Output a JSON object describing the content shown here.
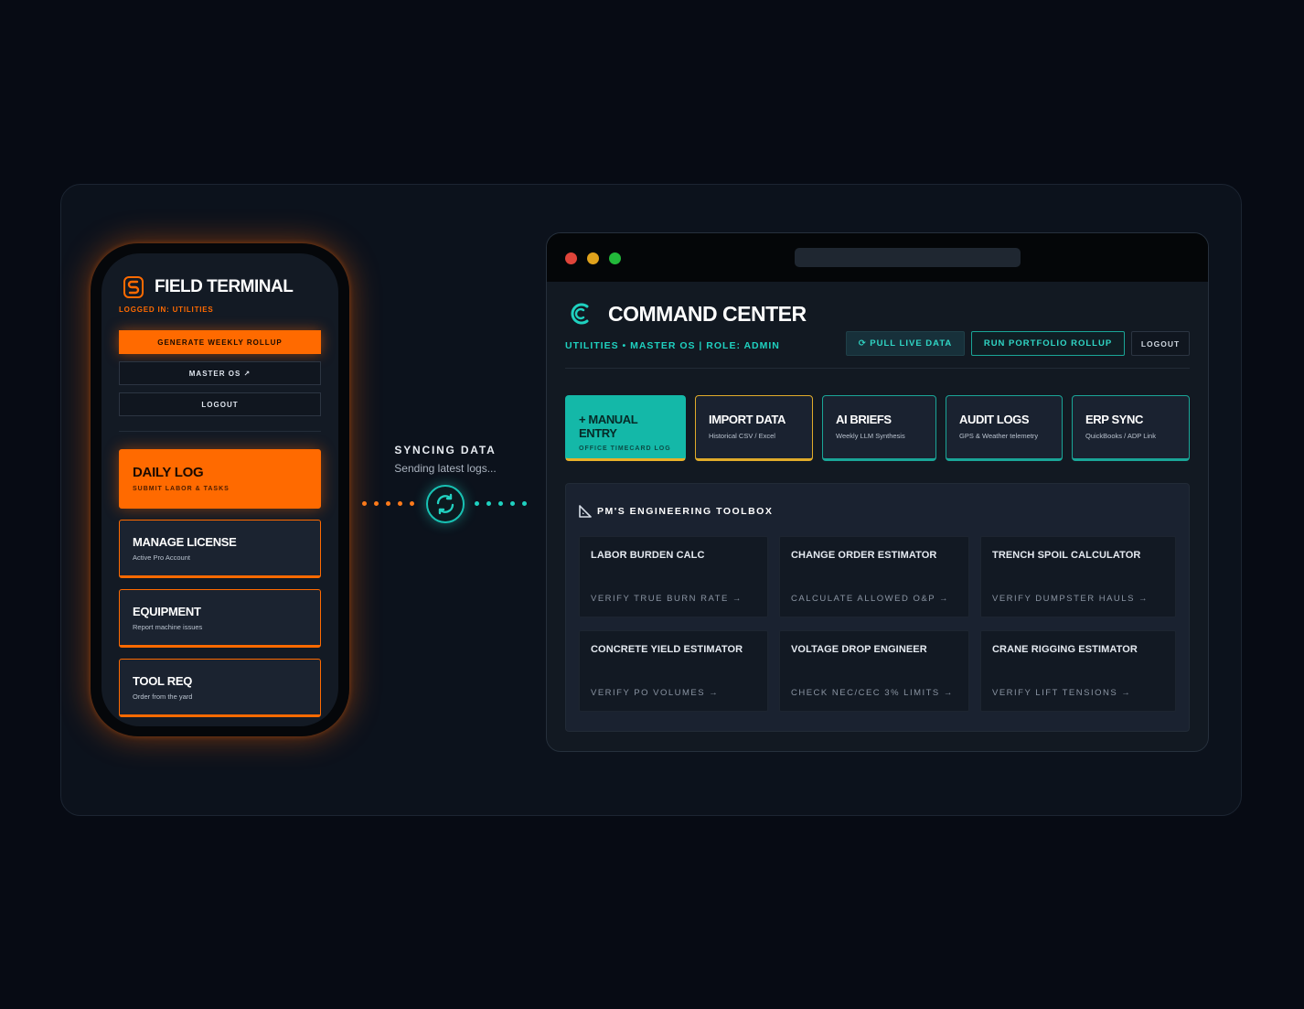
{
  "phone": {
    "title": "FIELD TERMINAL",
    "logged_in": "LOGGED IN: UTILITIES",
    "buttons": {
      "rollup": "GENERATE WEEKLY ROLLUP",
      "master_os": "MASTER OS ↗",
      "logout": "LOGOUT"
    },
    "cards": [
      {
        "title": "DAILY LOG",
        "subtitle": "SUBMIT LABOR & TASKS"
      },
      {
        "title": "MANAGE LICENSE",
        "subtitle": "Active Pro Account"
      },
      {
        "title": "EQUIPMENT",
        "subtitle": "Report machine issues"
      },
      {
        "title": "TOOL REQ",
        "subtitle": "Order from the yard"
      }
    ],
    "accent": "#ff6a00"
  },
  "sync": {
    "label": "SYNCING DATA",
    "sub": "Sending latest logs..."
  },
  "browser": {
    "title": "COMMAND CENTER",
    "subtitle": "UTILITIES • MASTER OS | ROLE: ADMIN",
    "buttons": {
      "pull": "⟳ PULL LIVE DATA",
      "rollup": "RUN PORTFOLIO ROLLUP",
      "logout": "LOGOUT"
    },
    "tiles": [
      {
        "title": "+ MANUAL ENTRY",
        "subtitle": "OFFICE TIMECARD LOG"
      },
      {
        "title": "IMPORT DATA",
        "subtitle": "Historical CSV / Excel"
      },
      {
        "title": "AI BRIEFS",
        "subtitle": "Weekly LLM Synthesis"
      },
      {
        "title": "AUDIT LOGS",
        "subtitle": "GPS & Weather telemetry"
      },
      {
        "title": "ERP SYNC",
        "subtitle": "QuickBooks / ADP Link"
      }
    ],
    "toolbox": {
      "title": "PM'S ENGINEERING TOOLBOX",
      "tools": [
        {
          "title": "LABOR BURDEN CALC",
          "action": "VERIFY TRUE BURN RATE →"
        },
        {
          "title": "CHANGE ORDER ESTIMATOR",
          "action": "CALCULATE ALLOWED O&P →"
        },
        {
          "title": "TRENCH SPOIL CALCULATOR",
          "action": "VERIFY DUMPSTER HAULS →"
        },
        {
          "title": "CONCRETE YIELD ESTIMATOR",
          "action": "VERIFY PO VOLUMES →"
        },
        {
          "title": "VOLTAGE DROP ENGINEER",
          "action": "CHECK NEC/CEC 3% LIMITS →"
        },
        {
          "title": "CRANE RIGGING ESTIMATOR",
          "action": "VERIFY LIFT TENSIONS →"
        }
      ]
    },
    "accent": "#1fd1c0",
    "window_dots": [
      "#e0443a",
      "#e0a21c",
      "#22b83a"
    ]
  }
}
